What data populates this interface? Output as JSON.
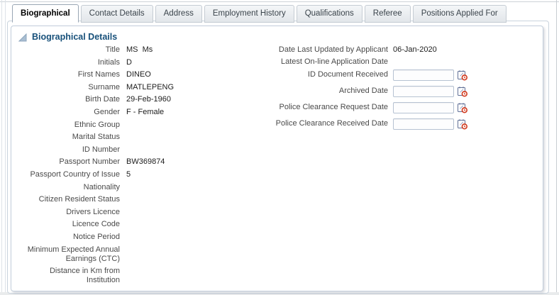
{
  "tabs": [
    {
      "label": "Biographical",
      "active": true
    },
    {
      "label": "Contact Details",
      "active": false
    },
    {
      "label": "Address",
      "active": false
    },
    {
      "label": "Employment History",
      "active": false
    },
    {
      "label": "Qualifications",
      "active": false
    },
    {
      "label": "Referee",
      "active": false
    },
    {
      "label": "Positions Applied For",
      "active": false
    }
  ],
  "panel": {
    "title": "Biographical Details",
    "disclosure_icon": "expanded-triangle",
    "left_fields": [
      {
        "label": "Title",
        "value": "MS  Ms"
      },
      {
        "label": "Initials",
        "value": "D"
      },
      {
        "label": "First Names",
        "value": "DINEO"
      },
      {
        "label": "Surname",
        "value": "MATLEPENG"
      },
      {
        "label": "Birth Date",
        "value": "29-Feb-1960"
      },
      {
        "label": "Gender",
        "value": "F - Female"
      },
      {
        "label": "Ethnic Group",
        "value": ""
      },
      {
        "label": "Marital Status",
        "value": ""
      },
      {
        "label": "ID Number",
        "value": ""
      },
      {
        "label": "Passport Number",
        "value": "BW369874"
      },
      {
        "label": "Passport Country of Issue",
        "value": "5"
      },
      {
        "label": "Nationality",
        "value": ""
      },
      {
        "label": "Citizen Resident Status",
        "value": ""
      },
      {
        "label": "Drivers Licence",
        "value": ""
      },
      {
        "label": "Licence Code",
        "value": ""
      },
      {
        "label": "Notice Period",
        "value": ""
      },
      {
        "label": "Minimum Expected Annual\nEarnings (CTC)",
        "value": ""
      },
      {
        "label": "Distance in Km from\nInstitution",
        "value": ""
      }
    ],
    "right_fields": [
      {
        "label": "Date Last Updated by Applicant",
        "value": "06-Jan-2020",
        "type": "text"
      },
      {
        "label": "Latest On-line Application Date",
        "value": "",
        "type": "text"
      },
      {
        "label": "ID Document Received",
        "value": "",
        "type": "date-input"
      },
      {
        "label": "Archived Date",
        "value": "",
        "type": "date-input"
      },
      {
        "label": "Police Clearance Request Date",
        "value": "",
        "type": "date-input"
      },
      {
        "label": "Police Clearance Received Date",
        "value": "",
        "type": "date-input"
      }
    ],
    "date_picker_icon": "calendar-with-red-clock"
  },
  "colors": {
    "header_text": "#17507a",
    "panel_border": "#c3cedb",
    "tab_active_bg": "#ffffff",
    "tab_inactive_bg": "#e9edf0",
    "input_border": "#b6c2d2",
    "date_icon_red": "#d2391d",
    "label_text": "#4a4a4a",
    "value_text": "#1c1c1c"
  }
}
